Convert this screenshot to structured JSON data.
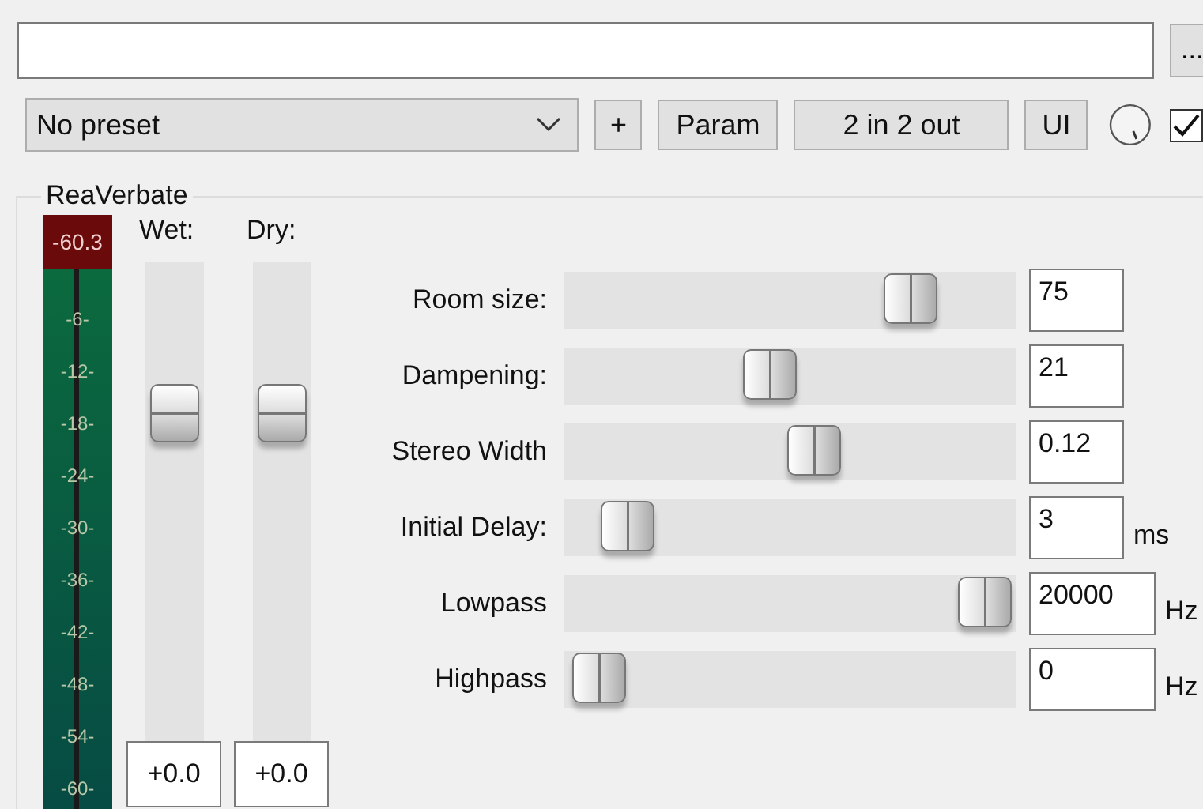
{
  "browse_button": "...",
  "preset": {
    "value": "No preset"
  },
  "buttons": [
    {
      "label": "+"
    },
    {
      "label": "Param"
    },
    {
      "label": "2 in 2 out"
    },
    {
      "label": "UI"
    }
  ],
  "enabled": {
    "checked": true
  },
  "plugin": {
    "title": "ReaVerbate",
    "meter": {
      "peak": "-60.3",
      "scale": [
        "-6-",
        "-12-",
        "-18-",
        "-24-",
        "-30-",
        "-36-",
        "-42-",
        "-48-",
        "-54-",
        "-60-"
      ]
    },
    "faders": [
      {
        "label": "Wet:",
        "level": 0.71,
        "value": "+0.0"
      },
      {
        "label": "Dry:",
        "level": 0.71,
        "value": "+0.0"
      }
    ],
    "params": [
      {
        "label": "Room size:",
        "kind": "standard",
        "level": 0.8,
        "value": "75"
      },
      {
        "label": "Dampening:",
        "kind": "standard",
        "level": 0.45,
        "value": "21"
      },
      {
        "label": "Stereo Width",
        "kind": "standard",
        "level": 0.56,
        "value": "0.12"
      },
      {
        "label": "Initial Delay:",
        "kind": "standard",
        "level": 0.09,
        "value": "3",
        "unit": "ms"
      },
      {
        "label": "Lowpass",
        "kind": "frequency",
        "level": 0.99,
        "value": "20000",
        "unit": "Hz"
      },
      {
        "label": "Highpass",
        "kind": "frequency",
        "level": 0.02,
        "value": "0",
        "unit": "Hz"
      }
    ]
  }
}
